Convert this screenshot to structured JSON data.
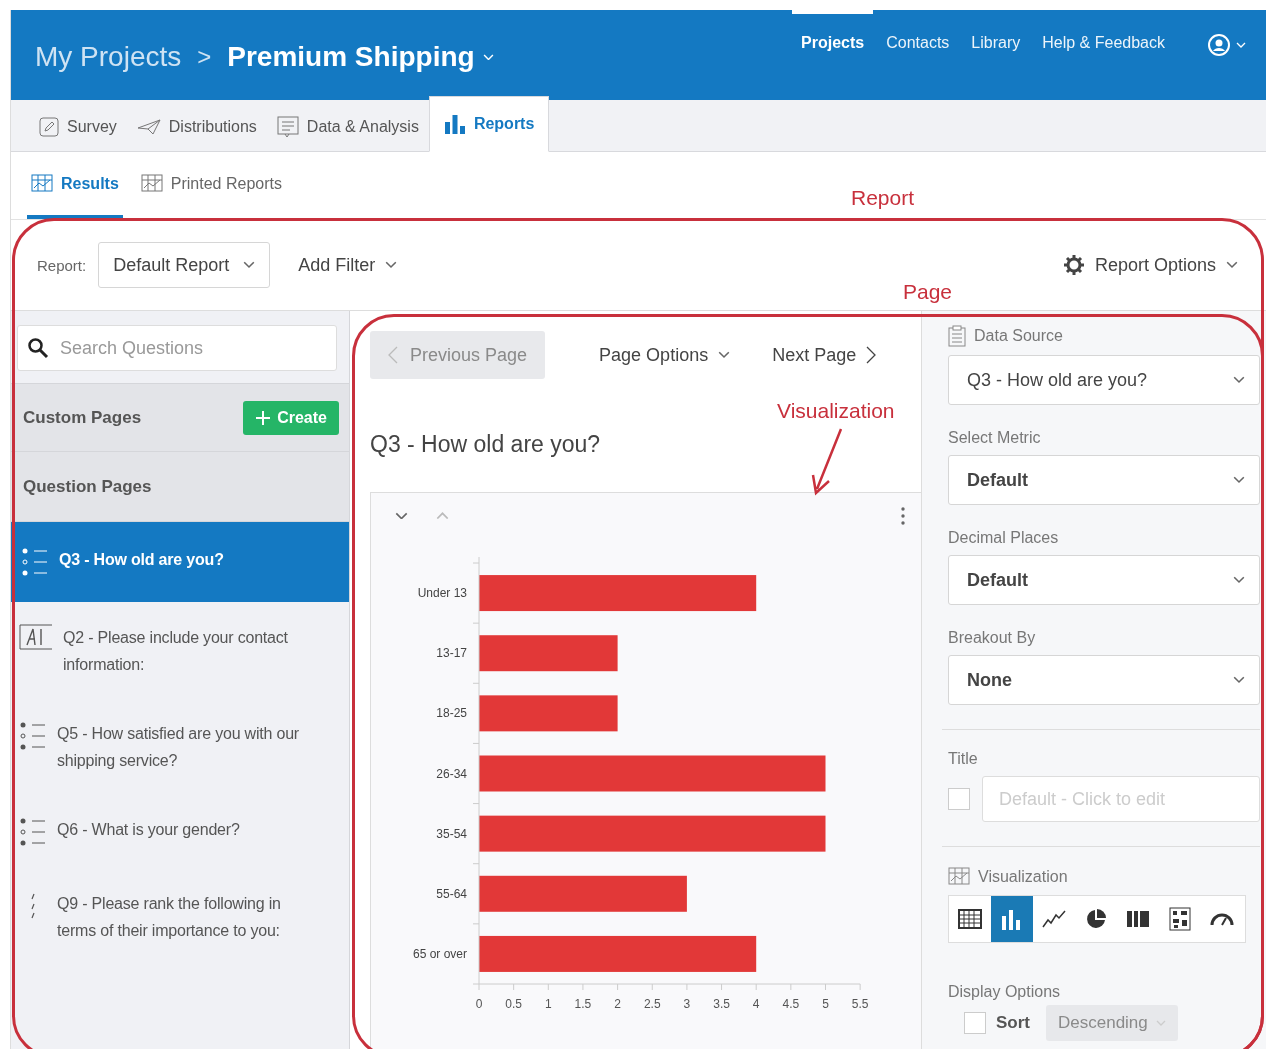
{
  "header": {
    "breadcrumb": "My Projects",
    "separator": ">",
    "project": "Premium Shipping",
    "nav": [
      {
        "label": "Projects",
        "selected": true
      },
      {
        "label": "Contacts",
        "selected": false
      },
      {
        "label": "Library",
        "selected": false
      },
      {
        "label": "Help & Feedback",
        "selected": false
      }
    ]
  },
  "tabs": [
    {
      "label": "Survey",
      "kind": "survey",
      "selected": false
    },
    {
      "label": "Distributions",
      "kind": "distributions",
      "selected": false
    },
    {
      "label": "Data & Analysis",
      "kind": "data",
      "selected": false
    },
    {
      "label": "Reports",
      "kind": "reports",
      "selected": true
    }
  ],
  "subtabs": [
    {
      "label": "Results",
      "selected": true
    },
    {
      "label": "Printed Reports",
      "selected": false
    }
  ],
  "toolbar": {
    "report_label": "Report:",
    "report_value": "Default Report",
    "add_filter": "Add Filter",
    "report_options": "Report Options"
  },
  "sidebar": {
    "search_placeholder": "Search Questions",
    "custom_pages": "Custom Pages",
    "create": "Create",
    "question_pages": "Question Pages",
    "items": [
      {
        "label": "Q3 - How old are you?",
        "kind": "choice",
        "selected": true
      },
      {
        "label": "Q2 - Please include your contact information:",
        "kind": "text",
        "selected": false
      },
      {
        "label": "Q5 - How satisfied are you with our shipping service?",
        "kind": "choice",
        "selected": false
      },
      {
        "label": "Q6 - What is your gender?",
        "kind": "choice",
        "selected": false
      },
      {
        "label": "Q9 - Please rank the following in terms of their importance to you:",
        "kind": "rank",
        "selected": false
      }
    ]
  },
  "page": {
    "previous": "Previous Page",
    "previous_disabled": true,
    "page_options": "Page Options",
    "next": "Next Page",
    "title": "Q3 - How old are you?",
    "chart_data": {
      "type": "bar",
      "orientation": "horizontal",
      "categories": [
        "Under 13",
        "13-17",
        "18-25",
        "26-34",
        "35-54",
        "55-64",
        "65 or over"
      ],
      "series": [
        {
          "color": "#e23838",
          "values": [
            4,
            2,
            2,
            5,
            5,
            3,
            4
          ]
        }
      ],
      "xlim": [
        0,
        5.5
      ],
      "xticks": [
        0,
        0.5,
        1,
        1.5,
        2,
        2.5,
        3,
        3.5,
        4,
        4.5,
        5,
        5.5
      ]
    }
  },
  "panel": {
    "data_source_label": "Data Source",
    "data_source": "Q3 - How old are you?",
    "metric_label": "Select Metric",
    "metric": "Default",
    "decimal_label": "Decimal Places",
    "decimal": "Default",
    "breakout_label": "Breakout By",
    "breakout": "None",
    "title_label": "Title",
    "title_checked": false,
    "title_placeholder": "Default - Click to edit",
    "visualization_label": "Visualization",
    "visualizations": [
      {
        "kind": "table",
        "selected": false
      },
      {
        "kind": "bar",
        "selected": true
      },
      {
        "kind": "line",
        "selected": false
      },
      {
        "kind": "pie",
        "selected": false
      },
      {
        "kind": "breakdown",
        "selected": false
      },
      {
        "kind": "heatmap",
        "selected": false
      },
      {
        "kind": "gauge",
        "selected": false
      }
    ],
    "display_label": "Display Options",
    "sort_label": "Sort",
    "sort_checked": false,
    "sort_order": "Descending"
  },
  "annotations": [
    {
      "kind": "region",
      "text": "Report"
    },
    {
      "kind": "region",
      "text": "Page"
    },
    {
      "kind": "callout",
      "text": "Visualization"
    }
  ]
}
